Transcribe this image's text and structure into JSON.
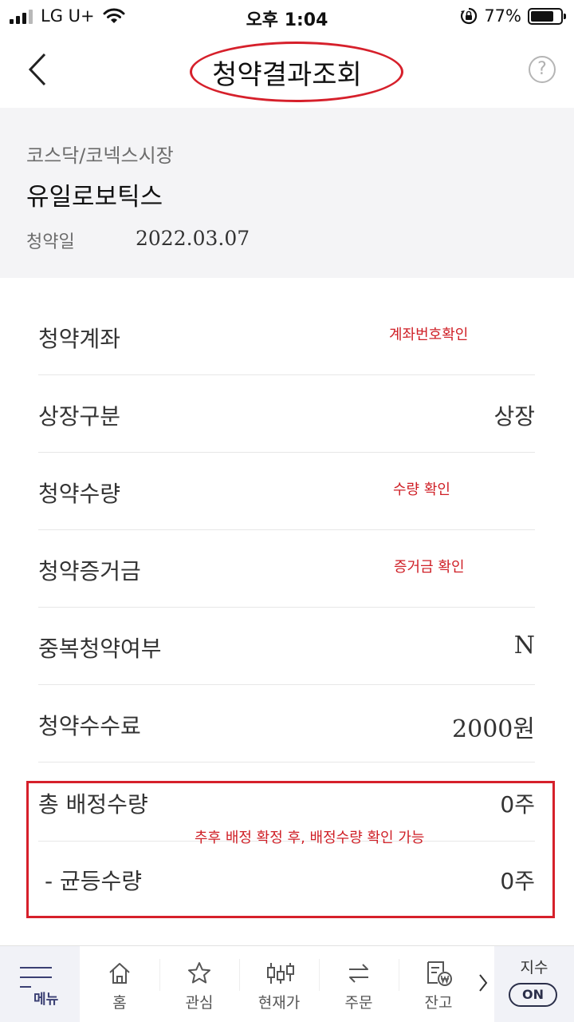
{
  "status_bar": {
    "carrier": "LG U+",
    "time": "오후 1:04",
    "battery_percent": "77%",
    "battery_level": 0.77
  },
  "header": {
    "title": "청약결과조회",
    "help_label": "?"
  },
  "summary": {
    "market": "코스닥/코넥스시장",
    "stock_name": "유일로보틱스",
    "date_label": "청약일",
    "date_value": "2022.03.07"
  },
  "rows": [
    {
      "label": "청약계좌",
      "value": "",
      "note": "계좌번호확인"
    },
    {
      "label": "상장구분",
      "value": "상장",
      "note": ""
    },
    {
      "label": "청약수량",
      "value": "",
      "note": "수량 확인"
    },
    {
      "label": "청약증거금",
      "value": "",
      "note": "증거금 확인"
    },
    {
      "label": "중복청약여부",
      "value": "N",
      "note": ""
    },
    {
      "label": "청약수수료",
      "value": "2000원",
      "note": ""
    }
  ],
  "allocation": {
    "total_label": "총 배정수량",
    "total_value": "0주",
    "equal_label": "- 균등수량",
    "equal_value": "0주",
    "note": "추후 배정 확정 후, 배정수량 확인 가능"
  },
  "bottom_nav": {
    "menu_label": "메뉴",
    "items": [
      {
        "label": "홈",
        "icon": "home-icon"
      },
      {
        "label": "관심",
        "icon": "star-icon"
      },
      {
        "label": "현재가",
        "icon": "candlestick-icon"
      },
      {
        "label": "주문",
        "icon": "swap-arrows-icon"
      },
      {
        "label": "잔고",
        "icon": "won-document-icon"
      }
    ],
    "index_label": "지수",
    "index_toggle": "ON"
  },
  "colors": {
    "annotation_red": "#d6202b",
    "summary_bg": "#f4f4f6",
    "nav_accent": "#3a3f73"
  }
}
